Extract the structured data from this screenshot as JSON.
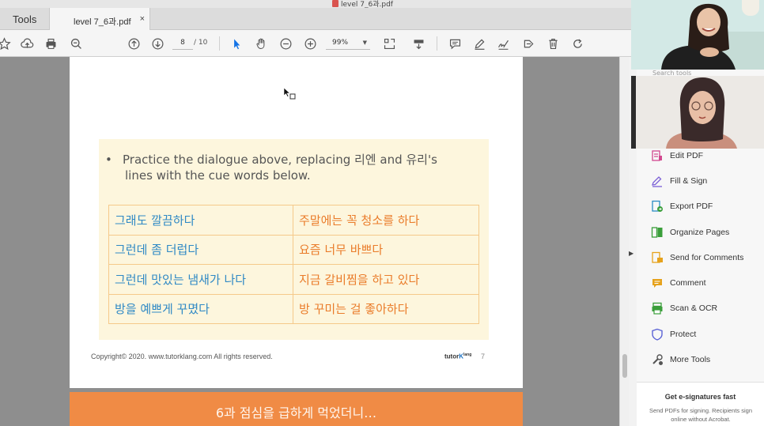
{
  "window": {
    "title": "level 7_6과.pdf"
  },
  "tabs": {
    "tools_label": "Tools",
    "doc_label": "level 7_6과.pdf",
    "close_glyph": "×"
  },
  "toolbar": {
    "current_page": "8",
    "total_pages": "/ 10",
    "zoom": "99%",
    "icons": [
      "star-icon",
      "cloud-upload-icon",
      "print-icon",
      "zoom-out-magnifier-icon",
      "page-up-icon",
      "page-down-icon",
      "select-cursor-icon",
      "hand-icon",
      "zoom-minus-icon",
      "zoom-plus-icon",
      "fit-page-icon",
      "scroll-mode-icon",
      "comment-icon",
      "highlight-pen-icon",
      "sign-icon",
      "share-icon",
      "delete-icon",
      "rotate-icon"
    ]
  },
  "page": {
    "instruction_bullet": "•",
    "instruction_line1": "Practice the dialogue above, replacing 리엔 and 유리's",
    "instruction_line2": "lines with the cue words below.",
    "cue_rows": [
      {
        "left": "그래도 깔끔하다",
        "right": "주말에는 꼭 청소를 하다"
      },
      {
        "left": "그런데 좀 더럽다",
        "right": "요즘 너무 바쁘다"
      },
      {
        "left": "그런데 맛있는 냄새가 나다",
        "right": "지금 갈비찜을 하고 있다"
      },
      {
        "left": "방을 예쁘게 꾸몄다",
        "right": "방 꾸미는 걸 좋아하다"
      }
    ],
    "copyright": "Copyright© 2020. www.tutorklang.com All rights reserved.",
    "brand_a": "tutor",
    "brand_b": "K",
    "brand_c": "lang",
    "page_number": "7",
    "next_page_title": "6과 점심을 급하게 먹었더니…",
    "colors": {
      "cue_left": "#2f89c5",
      "cue_right": "#ea7c2a",
      "table_border": "#f5c98a",
      "box_bg": "#fdf6dd",
      "next_page_bg": "#f08b45"
    }
  },
  "right_panel": {
    "search_placeholder": "Search tools",
    "tools": [
      {
        "label": "Edit PDF",
        "icon": "edit-pdf-icon",
        "color": "#d2488f"
      },
      {
        "label": "Fill & Sign",
        "icon": "fill-sign-icon",
        "color": "#7b5fd6"
      },
      {
        "label": "Export PDF",
        "icon": "export-pdf-icon",
        "color": "#2b8cc4"
      },
      {
        "label": "Organize Pages",
        "icon": "organize-pages-icon",
        "color": "#3a9e3a"
      },
      {
        "label": "Send for Comments",
        "icon": "send-comments-icon",
        "color": "#e6a21c"
      },
      {
        "label": "Comment",
        "icon": "comment-icon",
        "color": "#e6a21c"
      },
      {
        "label": "Scan & OCR",
        "icon": "scan-ocr-icon",
        "color": "#3a9e3a"
      },
      {
        "label": "Protect",
        "icon": "protect-icon",
        "color": "#5b63d6"
      },
      {
        "label": "More Tools",
        "icon": "more-tools-icon",
        "color": "#555555"
      }
    ],
    "esign_heading": "Get e-signatures fast",
    "esign_body": "Send PDFs for signing. Recipients sign online without Acrobat."
  }
}
